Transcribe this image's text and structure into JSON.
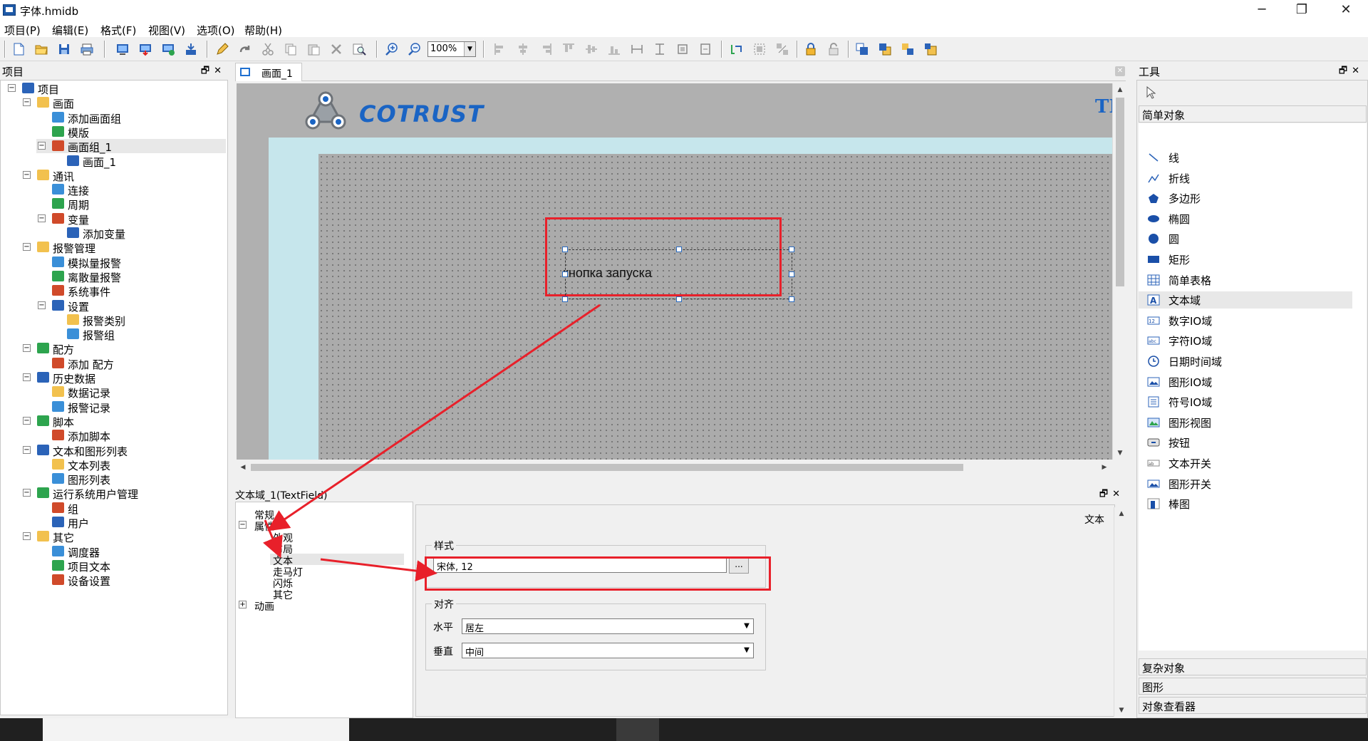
{
  "window": {
    "title": "字体.hmidb"
  },
  "menu": [
    "项目(P)",
    "编辑(E)",
    "格式(F)",
    "视图(V)",
    "选项(O)",
    "帮助(H)"
  ],
  "toolbar": {
    "zoom": "100%"
  },
  "project_panel": {
    "title": "项目",
    "tree": [
      {
        "level": 0,
        "label": "项目",
        "toggle": "−",
        "icon": "project-icon"
      },
      {
        "level": 1,
        "label": "画面",
        "toggle": "−",
        "icon": "folder-icon"
      },
      {
        "level": 2,
        "label": "添加画面组",
        "toggle": "",
        "icon": "add-screen-group-icon"
      },
      {
        "level": 2,
        "label": "模版",
        "toggle": "",
        "icon": "template-icon"
      },
      {
        "level": 2,
        "label": "画面组_1",
        "toggle": "−",
        "icon": "screen-group-icon",
        "selected": true
      },
      {
        "level": 3,
        "label": "画面_1",
        "toggle": "",
        "icon": "screen-icon"
      },
      {
        "level": 1,
        "label": "通讯",
        "toggle": "−",
        "icon": "folder-icon"
      },
      {
        "level": 2,
        "label": "连接",
        "toggle": "",
        "icon": "connection-icon"
      },
      {
        "level": 2,
        "label": "周期",
        "toggle": "",
        "icon": "cycle-icon"
      },
      {
        "level": 2,
        "label": "变量",
        "toggle": "−",
        "icon": "variable-icon"
      },
      {
        "level": 3,
        "label": "添加变量",
        "toggle": "",
        "icon": "add-variable-icon"
      },
      {
        "level": 1,
        "label": "报警管理",
        "toggle": "−",
        "icon": "alarm-folder-icon"
      },
      {
        "level": 2,
        "label": "模拟量报警",
        "toggle": "",
        "icon": "analog-alarm-icon"
      },
      {
        "level": 2,
        "label": "离散量报警",
        "toggle": "",
        "icon": "discrete-alarm-icon"
      },
      {
        "level": 2,
        "label": "系统事件",
        "toggle": "",
        "icon": "system-event-icon"
      },
      {
        "level": 2,
        "label": "设置",
        "toggle": "−",
        "icon": "settings-icon"
      },
      {
        "level": 3,
        "label": "报警类别",
        "toggle": "",
        "icon": "alarm-class-icon"
      },
      {
        "level": 3,
        "label": "报警组",
        "toggle": "",
        "icon": "alarm-group-icon"
      },
      {
        "level": 1,
        "label": "配方",
        "toggle": "−",
        "icon": "folder-icon"
      },
      {
        "level": 2,
        "label": "添加 配方",
        "toggle": "",
        "icon": "add-recipe-icon"
      },
      {
        "level": 1,
        "label": "历史数据",
        "toggle": "−",
        "icon": "folder-icon"
      },
      {
        "level": 2,
        "label": "数据记录",
        "toggle": "",
        "icon": "data-log-icon"
      },
      {
        "level": 2,
        "label": "报警记录",
        "toggle": "",
        "icon": "alarm-log-icon"
      },
      {
        "level": 1,
        "label": "脚本",
        "toggle": "−",
        "icon": "folder-icon"
      },
      {
        "level": 2,
        "label": "添加脚本",
        "toggle": "",
        "icon": "add-script-icon"
      },
      {
        "level": 1,
        "label": "文本和图形列表",
        "toggle": "−",
        "icon": "folder-icon"
      },
      {
        "level": 2,
        "label": "文本列表",
        "toggle": "",
        "icon": "text-list-icon"
      },
      {
        "level": 2,
        "label": "图形列表",
        "toggle": "",
        "icon": "graphic-list-icon"
      },
      {
        "level": 1,
        "label": "运行系统用户管理",
        "toggle": "−",
        "icon": "user-admin-icon"
      },
      {
        "level": 2,
        "label": "组",
        "toggle": "",
        "icon": "group-icon"
      },
      {
        "level": 2,
        "label": "用户",
        "toggle": "",
        "icon": "user-icon"
      },
      {
        "level": 1,
        "label": "其它",
        "toggle": "−",
        "icon": "folder-icon"
      },
      {
        "level": 2,
        "label": "调度器",
        "toggle": "",
        "icon": "scheduler-icon"
      },
      {
        "level": 2,
        "label": "项目文本",
        "toggle": "",
        "icon": "project-text-icon"
      },
      {
        "level": 2,
        "label": "设备设置",
        "toggle": "",
        "icon": "device-settings-icon"
      }
    ]
  },
  "editor": {
    "tab": "画面_1",
    "logo_text": "COTRUST",
    "logo_right": "TI",
    "textfield_text": "кнопка  запуска"
  },
  "properties": {
    "title": "文本域_1(TextField)",
    "tree": [
      {
        "level": 1,
        "label": "常规",
        "toggle": ""
      },
      {
        "level": 1,
        "label": "属性",
        "toggle": "−"
      },
      {
        "level": 2,
        "label": "外观",
        "toggle": ""
      },
      {
        "level": 2,
        "label": "布局",
        "toggle": ""
      },
      {
        "level": 2,
        "label": "文本",
        "toggle": "",
        "selected": true
      },
      {
        "level": 2,
        "label": "走马灯",
        "toggle": ""
      },
      {
        "level": 2,
        "label": "闪烁",
        "toggle": ""
      },
      {
        "level": 2,
        "label": "其它",
        "toggle": ""
      },
      {
        "level": 1,
        "label": "动画",
        "toggle": "+"
      }
    ],
    "page_title": "文本",
    "style_group": "样式",
    "font_value": "宋体, 12",
    "font_button": "...",
    "align_group": "对齐",
    "horizontal_label": "水平",
    "horizontal_value": "居左",
    "vertical_label": "垂直",
    "vertical_value": "中间"
  },
  "tools_panel": {
    "title": "工具",
    "simple_section": "简单对象",
    "items": [
      {
        "label": "线",
        "icon": "line-icon"
      },
      {
        "label": "折线",
        "icon": "polyline-icon"
      },
      {
        "label": "多边形",
        "icon": "polygon-icon"
      },
      {
        "label": "椭圆",
        "icon": "ellipse-icon"
      },
      {
        "label": "圆",
        "icon": "circle-icon"
      },
      {
        "label": "矩形",
        "icon": "rectangle-icon"
      },
      {
        "label": "简单表格",
        "icon": "table-icon"
      },
      {
        "label": "文本域",
        "icon": "text-field-icon",
        "selected": true
      },
      {
        "label": "数字IO域",
        "icon": "numeric-io-icon"
      },
      {
        "label": "字符IO域",
        "icon": "string-io-icon"
      },
      {
        "label": "日期时间域",
        "icon": "datetime-icon"
      },
      {
        "label": "图形IO域",
        "icon": "graphic-io-icon"
      },
      {
        "label": "符号IO域",
        "icon": "symbolic-io-icon"
      },
      {
        "label": "图形视图",
        "icon": "graphic-view-icon"
      },
      {
        "label": "按钮",
        "icon": "button-icon"
      },
      {
        "label": "文本开关",
        "icon": "text-switch-icon"
      },
      {
        "label": "图形开关",
        "icon": "graphic-switch-icon"
      },
      {
        "label": "棒图",
        "icon": "bar-graph-icon"
      }
    ],
    "complex_section": "复杂对象",
    "graphics_section": "图形",
    "object_viewer_section": "对象查看器"
  }
}
